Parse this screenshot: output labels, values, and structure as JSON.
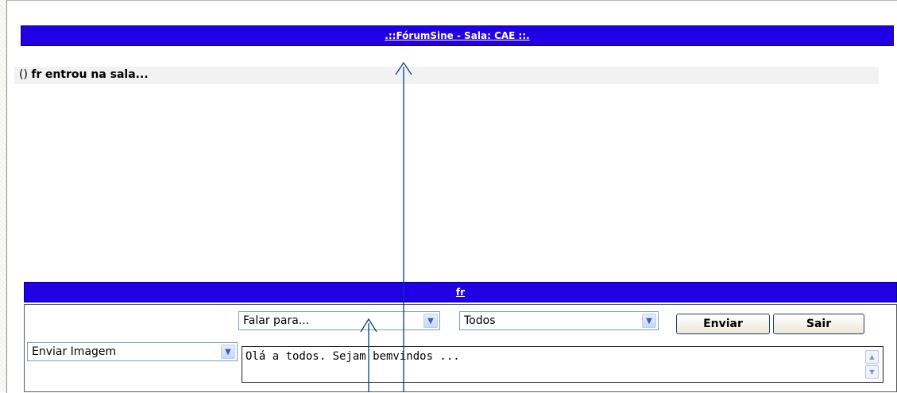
{
  "header": {
    "room_title": ".::FórumSine - Sala: CAE ::."
  },
  "messages": [
    {
      "prefix": "()",
      "user": "fr",
      "text": "entrou na sala..."
    }
  ],
  "bottom_bar": {
    "user_name": "fr"
  },
  "controls": {
    "recipient_select": "Falar para...",
    "target_select": "Todos",
    "send_button": "Enviar",
    "exit_button": "Sair",
    "image_select": "Enviar Imagem",
    "message_text": "Olá a todos. Sejam bemvindos ..."
  },
  "icons": {
    "dropdown": "chevron-down-icon",
    "scroll_up": "chevron-up-icon",
    "scroll_down": "chevron-down-icon"
  }
}
